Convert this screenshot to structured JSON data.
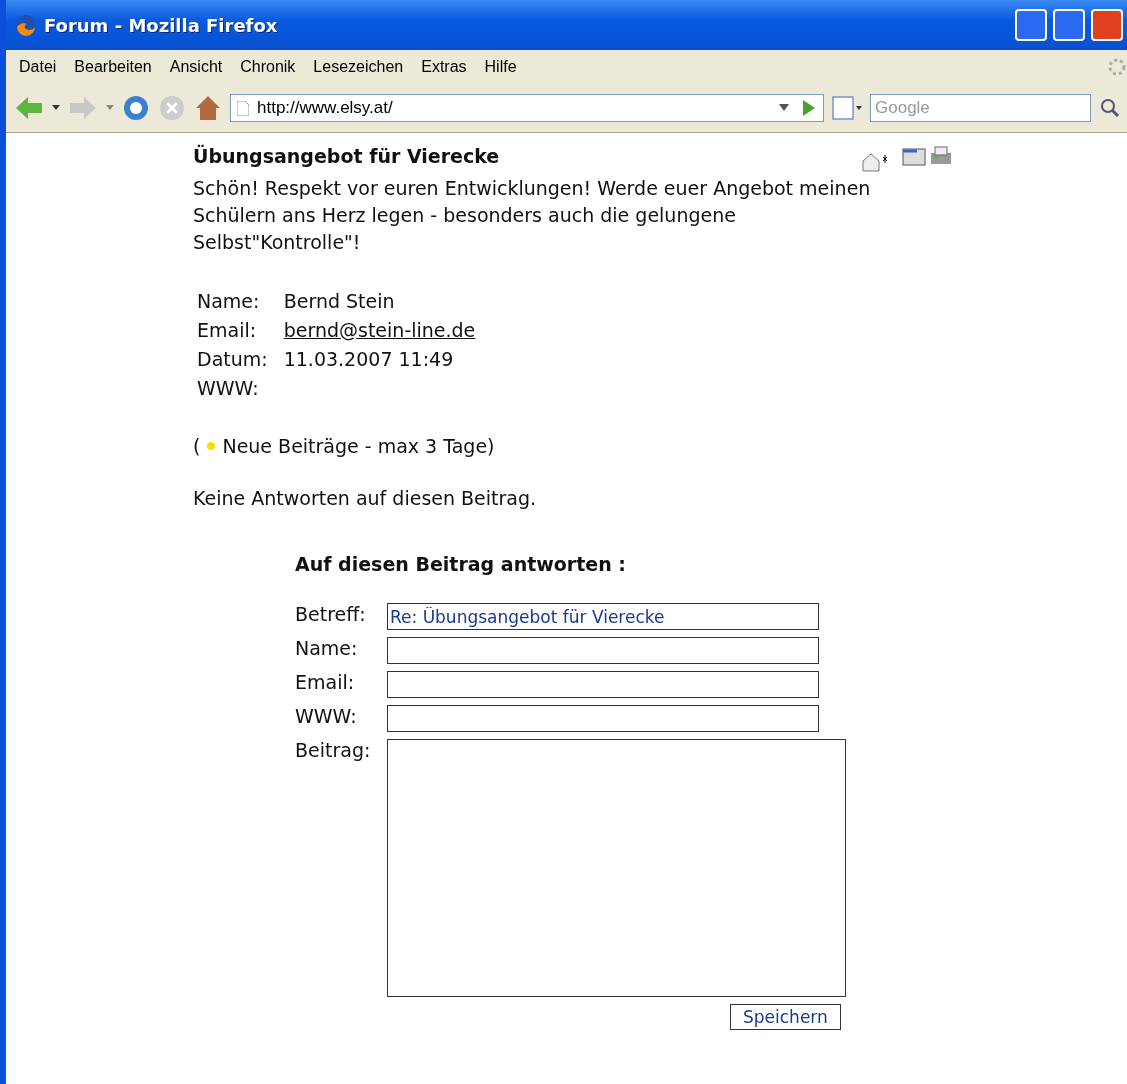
{
  "window": {
    "title": "Forum - Mozilla Firefox"
  },
  "menu": [
    "Datei",
    "Bearbeiten",
    "Ansicht",
    "Chronik",
    "Lesezeichen",
    "Extras",
    "Hilfe"
  ],
  "toolbar": {
    "url": "http://www.elsy.at/",
    "search_placeholder": "Google"
  },
  "post": {
    "title": "Übungsangebot für Vierecke",
    "body": "Schön! Respekt vor euren Entwicklungen! Werde euer Angebot meinen Schülern ans Herz legen - besonders auch die gelungene Selbst\"Kontrolle\"!",
    "fields": [
      {
        "label": "Name:",
        "value": "Bernd Stein",
        "kind": "text"
      },
      {
        "label": "Email:",
        "value": "bernd@stein-line.de",
        "kind": "link"
      },
      {
        "label": "Datum:",
        "value": "11.03.2007 11:49",
        "kind": "text"
      },
      {
        "label": "WWW:",
        "kind": "text"
      }
    ],
    "legend_open": "(",
    "legend": "Neue Beiträge - max 3 Tage)",
    "replies_note": "Keine Antworten auf diesen Beitrag."
  },
  "reply_form": {
    "title": "Auf diesen Beitrag antworten :",
    "fields": [
      {
        "label": "Betreff:",
        "value": "Re: Übungsangebot für Vierecke",
        "kind": "input"
      },
      {
        "label": "Name:",
        "kind": "input"
      },
      {
        "label": "Email:",
        "kind": "input"
      },
      {
        "label": "WWW:",
        "kind": "input"
      },
      {
        "label": "Beitrag:",
        "kind": "textarea"
      }
    ],
    "submit": "Speichern"
  }
}
